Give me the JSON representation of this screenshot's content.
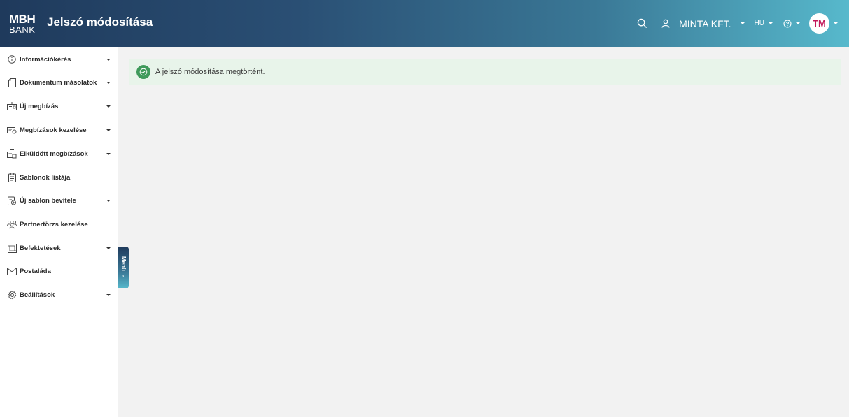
{
  "header": {
    "logo_top": "MBH",
    "logo_bottom": "BANK",
    "title": "Jelszó módosítása",
    "company": "MINTA KFT.",
    "language": "HU",
    "avatar_initials": "TM",
    "icons": [
      "search-icon",
      "user-icon",
      "help-icon"
    ],
    "accent_gradient": [
      "#1f3a5c",
      "#57b9cc"
    ],
    "avatar_text_color": "#c2185b"
  },
  "sidebar": {
    "items": [
      {
        "label": "Információkérés",
        "icon": "info-icon",
        "has_submenu": true
      },
      {
        "label": "Dokumentum másolatok",
        "icon": "document-icon",
        "has_submenu": true
      },
      {
        "label": "Új megbízás",
        "icon": "new-order-icon",
        "has_submenu": true
      },
      {
        "label": "Megbízások kezelése",
        "icon": "orders-manage-icon",
        "has_submenu": true
      },
      {
        "label": "Elküldött megbízások",
        "icon": "sent-orders-icon",
        "has_submenu": true
      },
      {
        "label": "Sablonok listája",
        "icon": "template-list-icon",
        "has_submenu": false
      },
      {
        "label": "Új sablon bevitele",
        "icon": "new-template-icon",
        "has_submenu": true
      },
      {
        "label": "Partnertörzs kezelése",
        "icon": "partners-icon",
        "has_submenu": false
      },
      {
        "label": "Befektetések",
        "icon": "investments-icon",
        "has_submenu": true
      },
      {
        "label": "Postaláda",
        "icon": "mail-icon",
        "has_submenu": false
      },
      {
        "label": "Beállítások",
        "icon": "settings-icon",
        "has_submenu": true
      }
    ],
    "menu_toggle_label": "Menü"
  },
  "main": {
    "alert": {
      "message": "A jelszó módosítása megtörtént.",
      "status_color": "#3f9a5b"
    }
  }
}
